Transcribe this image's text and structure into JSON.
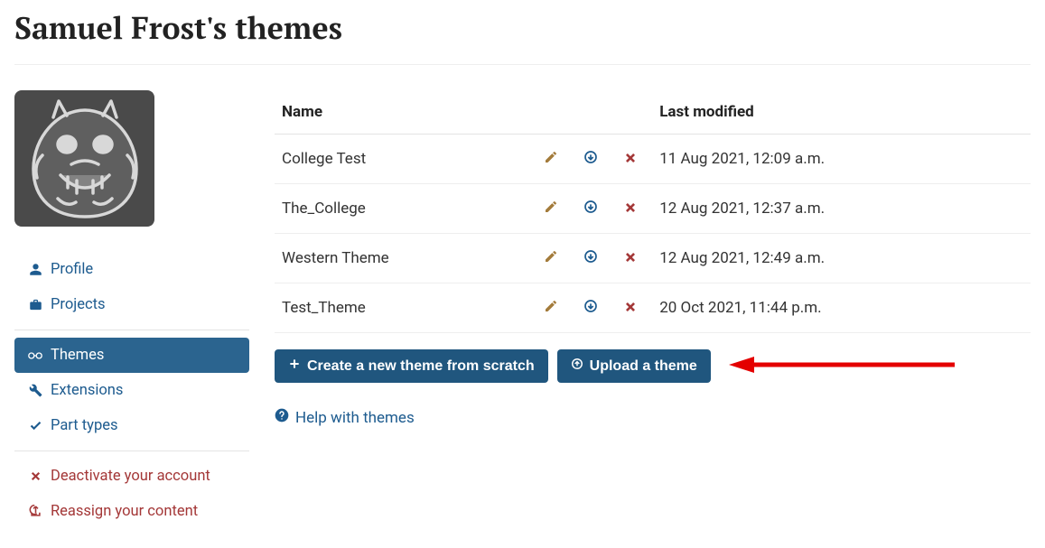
{
  "header": {
    "title": "Samuel Frost's themes"
  },
  "sidebar": {
    "items": [
      {
        "label": "Profile",
        "icon": "user-icon",
        "danger": false
      },
      {
        "label": "Projects",
        "icon": "briefcase-icon",
        "danger": false
      },
      {
        "label": "Themes",
        "icon": "eye-icon",
        "danger": false,
        "active": true
      },
      {
        "label": "Extensions",
        "icon": "wrench-icon",
        "danger": false
      },
      {
        "label": "Part types",
        "icon": "check-icon",
        "danger": false
      },
      {
        "label": "Deactivate your account",
        "icon": "x-icon",
        "danger": true
      },
      {
        "label": "Reassign your content",
        "icon": "share-icon",
        "danger": true
      }
    ]
  },
  "table": {
    "col_name": "Name",
    "col_modified": "Last modified",
    "rows": [
      {
        "name": "College Test",
        "modified": "11 Aug 2021, 12:09 a.m."
      },
      {
        "name": "The_College",
        "modified": "12 Aug 2021, 12:37 a.m."
      },
      {
        "name": "Western Theme",
        "modified": "12 Aug 2021, 12:49 a.m."
      },
      {
        "name": "Test_Theme",
        "modified": "20 Oct 2021, 11:44 p.m."
      }
    ]
  },
  "buttons": {
    "create": "Create a new theme from scratch",
    "upload": "Upload a theme"
  },
  "help": {
    "label": "Help with themes"
  }
}
